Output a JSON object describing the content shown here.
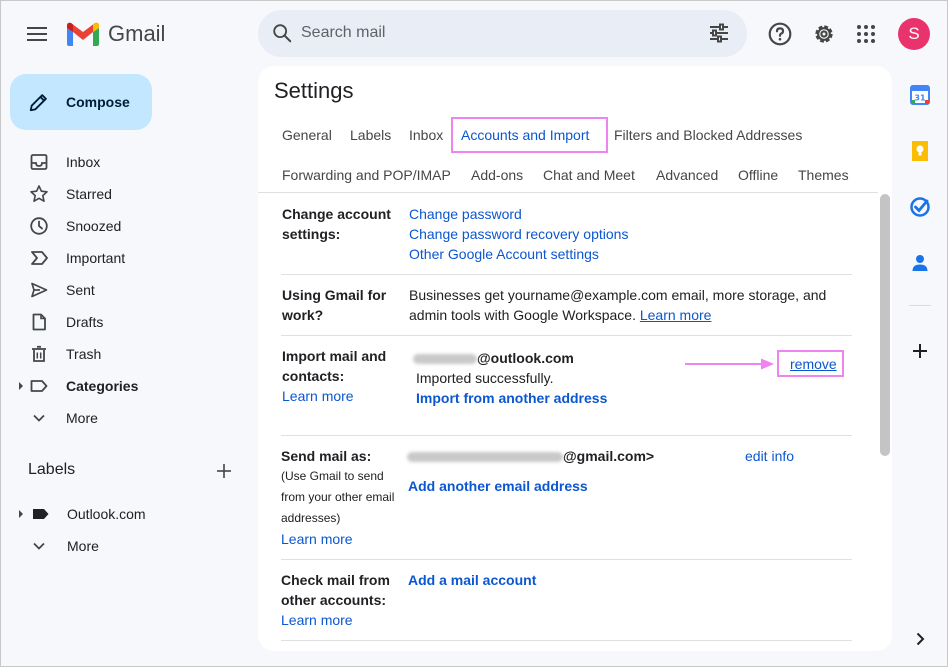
{
  "header": {
    "app_name": "Gmail",
    "search_placeholder": "Search mail",
    "avatar_letter": "S"
  },
  "compose": {
    "label": "Compose"
  },
  "nav": {
    "items": [
      {
        "label": "Inbox",
        "icon": "inbox-icon"
      },
      {
        "label": "Starred",
        "icon": "star-icon"
      },
      {
        "label": "Snoozed",
        "icon": "clock-icon"
      },
      {
        "label": "Important",
        "icon": "important-icon"
      },
      {
        "label": "Sent",
        "icon": "send-icon"
      },
      {
        "label": "Drafts",
        "icon": "draft-icon"
      },
      {
        "label": "Trash",
        "icon": "trash-icon"
      },
      {
        "label": "Categories",
        "icon": "label-icon"
      },
      {
        "label": "More",
        "icon": "chevron-down-icon"
      }
    ],
    "labels_heading": "Labels",
    "labels": [
      {
        "label": "Outlook.com"
      },
      {
        "label": "More"
      }
    ]
  },
  "settings": {
    "title": "Settings",
    "tabs_row1": [
      "General",
      "Labels",
      "Inbox",
      "Accounts and Import",
      "Filters and Blocked Addresses"
    ],
    "tabs_row2": [
      "Forwarding and POP/IMAP",
      "Add-ons",
      "Chat and Meet",
      "Advanced",
      "Offline",
      "Themes"
    ],
    "active_tab": "Accounts and Import",
    "rows": {
      "change_account": {
        "label_line1": "Change account",
        "label_line2": "settings:",
        "links": [
          "Change password",
          "Change password recovery options",
          "Other Google Account settings"
        ]
      },
      "work": {
        "label_line1": "Using Gmail for",
        "label_line2": "work?",
        "text_line1": "Businesses get yourname@example.com email, more storage, and",
        "text_line2": "admin tools with Google Workspace.",
        "learn_more": "Learn more"
      },
      "import": {
        "label_line1": "Import mail and",
        "label_line2": "contacts:",
        "learn_more": "Learn more",
        "account_domain": "@outlook.com",
        "status": "Imported successfully.",
        "import_another": "Import from another address",
        "remove": "remove"
      },
      "send_as": {
        "label": "Send mail as:",
        "sub_line1": "(Use Gmail to send",
        "sub_line2": "from your other email",
        "sub_line3": "addresses)",
        "learn_more": "Learn more",
        "address_domain": "@gmail.com>",
        "edit_info": "edit info",
        "add_another": "Add another email address"
      },
      "check_mail": {
        "label_line1": "Check mail from",
        "label_line2": "other accounts:",
        "learn_more": "Learn more",
        "add_account": "Add a mail account"
      }
    }
  },
  "colors": {
    "accent": "#0b57d0",
    "highlight": "#ee84f0",
    "compose_bg": "#c2e7ff",
    "avatar_bg": "#e8336c"
  }
}
